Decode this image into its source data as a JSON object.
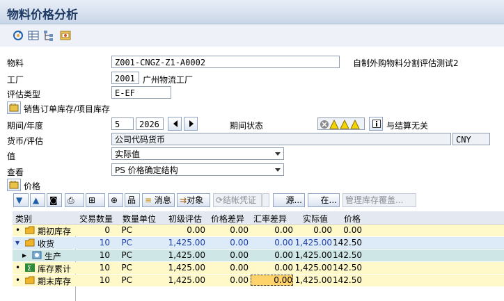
{
  "title": "物料价格分析",
  "colors": {
    "title_bg": "#c9d6e8",
    "row_yellow": "#fff9c9",
    "row_blue": "#dcebf7",
    "row_teal": "#cfe6e6",
    "highlight": "#ffd36b"
  },
  "app_toolbar_icons": [
    "refresh-icon",
    "display-icon",
    "hierarchy-icon",
    "settings-icon"
  ],
  "form": {
    "material_label": "物料",
    "material_value": "Z001-CNGZ-Z1-A0002",
    "material_desc": "自制外购物料分割评估测试2",
    "plant_label": "工厂",
    "plant_value": "2001",
    "plant_desc": "广州物流工厂",
    "valtype_label": "评估类型",
    "valtype_value": "E-EF",
    "sales_order_stock_label": "销售订单库存/项目库存",
    "period_label": "期间/年度",
    "period_value": "5",
    "year_value": "2026",
    "period_status_label": "期间状态",
    "period_status_text": "与结算无关",
    "currency_label": "货币/评估",
    "currency_value": "公司代码货币",
    "currency_code": "CNY",
    "value_label": "值",
    "value_value": "实际值",
    "view_label": "查看",
    "view_value": "PS 价格确定结构",
    "price_label": "价格"
  },
  "grid_toolbar": {
    "messages": "消息",
    "object": "对象",
    "close_docs": "结帐凭证",
    "source": "源...",
    "in": "在...",
    "manage_stock": "管理库存覆盖..."
  },
  "table": {
    "headers": [
      "类别",
      "交易数量",
      "数量单位",
      "初级评估",
      "价格差异",
      "汇率差异",
      "实际值",
      "价格"
    ],
    "rows": [
      {
        "cat": "期初库存",
        "qty": "0",
        "unit": "PC",
        "prim": "0.00",
        "pdiff": "0.00",
        "xdiff": "0.00",
        "actual": "0.00",
        "price": "0.00"
      },
      {
        "cat": "收货",
        "qty": "10",
        "unit": "PC",
        "prim": "1,425.00",
        "pdiff": "0.00",
        "xdiff": "0.00",
        "actual": "1,425.00",
        "price": "142.50"
      },
      {
        "cat": "生产",
        "qty": "10",
        "unit": "PC",
        "prim": "1,425.00",
        "pdiff": "0.00",
        "xdiff": "0.00",
        "actual": "1,425.00",
        "price": "142.50"
      },
      {
        "cat": "库存累计",
        "qty": "10",
        "unit": "PC",
        "prim": "1,425.00",
        "pdiff": "0.00",
        "xdiff": "0.00",
        "actual": "1,425.00",
        "price": "142.50"
      },
      {
        "cat": "期末库存",
        "qty": "10",
        "unit": "PC",
        "prim": "1,425.00",
        "pdiff": "0.00",
        "xdiff": "0.00",
        "actual": "1,425.00",
        "price": "142.50"
      }
    ]
  }
}
